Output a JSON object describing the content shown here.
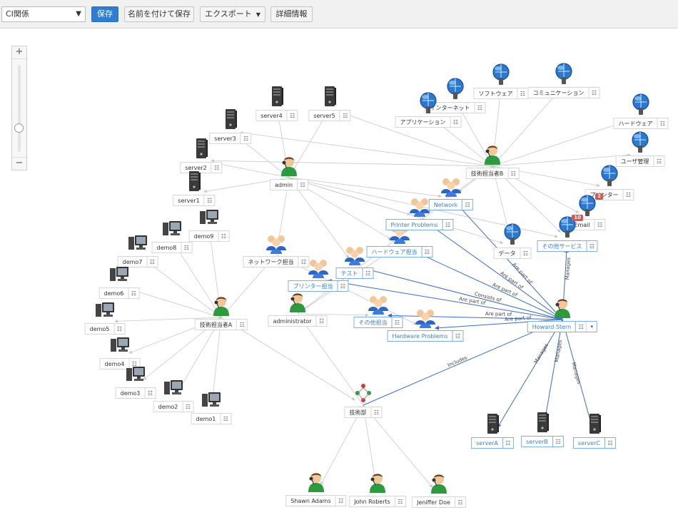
{
  "toolbar": {
    "select_value": "CI関係",
    "save": "保存",
    "save_as": "名前を付けて保存",
    "export": "エクスポート",
    "details": "詳細情報"
  },
  "zoom": {
    "in": "+",
    "out": "−",
    "level": 0.32
  },
  "colors": {
    "primary": "#2e7dd2",
    "edge": "#c8c8c8",
    "relation_edge": "#3a6cc8",
    "badge": "#d9534f"
  },
  "graph": {
    "nodes": [
      {
        "id": "ci",
        "label": "CI関係"
      },
      {
        "id": "server4",
        "label": "server4",
        "icon": "server-icon"
      },
      {
        "id": "server5",
        "label": "server5",
        "icon": "server-icon"
      },
      {
        "id": "server3",
        "label": "server3",
        "icon": "server-icon"
      },
      {
        "id": "server2",
        "label": "server2",
        "icon": "server-icon"
      },
      {
        "id": "server1",
        "label": "server1",
        "icon": "server-icon"
      },
      {
        "id": "admin",
        "label": "admin",
        "icon": "user-icon"
      },
      {
        "id": "demo9",
        "label": "demo9",
        "icon": "pc-icon"
      },
      {
        "id": "demo8",
        "label": "demo8",
        "icon": "pc-icon"
      },
      {
        "id": "demo7",
        "label": "demo7",
        "icon": "pc-icon"
      },
      {
        "id": "demo6",
        "label": "demo6",
        "icon": "pc-icon"
      },
      {
        "id": "demo5",
        "label": "demo5",
        "icon": "pc-icon"
      },
      {
        "id": "demo4",
        "label": "demo4",
        "icon": "pc-icon"
      },
      {
        "id": "demo3",
        "label": "demo3",
        "icon": "pc-icon"
      },
      {
        "id": "demo2",
        "label": "demo2",
        "icon": "pc-icon"
      },
      {
        "id": "demo1",
        "label": "demo1",
        "icon": "pc-icon"
      },
      {
        "id": "techA",
        "label": "技術担当者A",
        "icon": "user-icon"
      },
      {
        "id": "net",
        "label": "ネットワーク担当",
        "icon": "group-icon"
      },
      {
        "id": "printer_t",
        "label": "プリンター担当",
        "icon": "group-icon"
      },
      {
        "id": "test",
        "label": "テスト",
        "icon": "group-icon"
      },
      {
        "id": "administrator",
        "label": "administrator",
        "icon": "user-icon"
      },
      {
        "id": "other_t",
        "label": "その他担当",
        "icon": "group-icon"
      },
      {
        "id": "hw_t",
        "label": "ハードウェア担当",
        "icon": "group-icon"
      },
      {
        "id": "printer_p",
        "label": "Printer Problems",
        "icon": "group-icon"
      },
      {
        "id": "network",
        "label": "Network",
        "icon": "group-icon"
      },
      {
        "id": "hw_p",
        "label": "Hardware Problems",
        "icon": "group-icon"
      },
      {
        "id": "techB",
        "label": "技術担当者B",
        "icon": "user-icon"
      },
      {
        "id": "internet",
        "label": "インターネット",
        "icon": "service-icon"
      },
      {
        "id": "software",
        "label": "ソフトウェア",
        "icon": "service-icon"
      },
      {
        "id": "comm",
        "label": "コミュニケーション",
        "icon": "service-icon"
      },
      {
        "id": "app",
        "label": "アプリケーション",
        "icon": "service-icon"
      },
      {
        "id": "hardware",
        "label": "ハードウェア",
        "icon": "service-icon"
      },
      {
        "id": "usermgmt",
        "label": "ユーザ管理",
        "icon": "service-icon"
      },
      {
        "id": "printer",
        "label": "プリンター",
        "icon": "service-icon"
      },
      {
        "id": "email",
        "label": "Email",
        "icon": "service-icon",
        "badge": "2"
      },
      {
        "id": "other_s",
        "label": "その他サービス",
        "icon": "service-icon",
        "badge": "10"
      },
      {
        "id": "data",
        "label": "データ",
        "icon": "service-icon"
      },
      {
        "id": "howard",
        "label": "Howard Stern",
        "icon": "user-icon"
      },
      {
        "id": "dept",
        "label": "技術部",
        "icon": "org-icon"
      },
      {
        "id": "serverA",
        "label": "serverA",
        "icon": "server-icon"
      },
      {
        "id": "serverB",
        "label": "serverB",
        "icon": "server-icon"
      },
      {
        "id": "serverC",
        "label": "serverC",
        "icon": "server-icon"
      },
      {
        "id": "shawn",
        "label": "Shawn Adams",
        "icon": "user-icon"
      },
      {
        "id": "john",
        "label": "John Roberts",
        "icon": "user-icon"
      },
      {
        "id": "jeniffer",
        "label": "Jeniffer Doe",
        "icon": "user-icon"
      }
    ],
    "edges": [
      {
        "from": "admin",
        "to": "server4"
      },
      {
        "from": "admin",
        "to": "server5"
      },
      {
        "from": "admin",
        "to": "server3"
      },
      {
        "from": "admin",
        "to": "server2"
      },
      {
        "from": "admin",
        "to": "server1"
      },
      {
        "from": "admin",
        "to": "network"
      },
      {
        "from": "admin",
        "to": "printer_p"
      },
      {
        "from": "admin",
        "to": "hw_t"
      },
      {
        "from": "admin",
        "to": "test"
      },
      {
        "from": "admin",
        "to": "net"
      },
      {
        "from": "admin",
        "to": "other_s"
      },
      {
        "from": "admin",
        "to": "data"
      },
      {
        "from": "techB",
        "to": "internet"
      },
      {
        "from": "techB",
        "to": "software"
      },
      {
        "from": "techB",
        "to": "comm"
      },
      {
        "from": "techB",
        "to": "app"
      },
      {
        "from": "techB",
        "to": "hardware"
      },
      {
        "from": "techB",
        "to": "usermgmt"
      },
      {
        "from": "techB",
        "to": "printer"
      },
      {
        "from": "techB",
        "to": "email"
      },
      {
        "from": "techB",
        "to": "other_s"
      },
      {
        "from": "techB",
        "to": "data"
      },
      {
        "from": "techB",
        "to": "server3"
      },
      {
        "from": "techB",
        "to": "server5"
      },
      {
        "from": "techB",
        "to": "server2"
      },
      {
        "from": "techB",
        "to": "network"
      },
      {
        "from": "techB",
        "to": "printer_p"
      },
      {
        "from": "techA",
        "to": "demo9"
      },
      {
        "from": "techA",
        "to": "demo8"
      },
      {
        "from": "techA",
        "to": "demo7"
      },
      {
        "from": "techA",
        "to": "demo6"
      },
      {
        "from": "techA",
        "to": "demo5"
      },
      {
        "from": "techA",
        "to": "demo4"
      },
      {
        "from": "techA",
        "to": "demo3"
      },
      {
        "from": "techA",
        "to": "demo2"
      },
      {
        "from": "techA",
        "to": "demo1"
      },
      {
        "from": "techA",
        "to": "net"
      },
      {
        "from": "techA",
        "to": "dept"
      },
      {
        "from": "net",
        "to": "hw_p"
      },
      {
        "from": "administrator",
        "to": "other_t"
      },
      {
        "from": "administrator",
        "to": "hw_t"
      },
      {
        "from": "administrator",
        "to": "network"
      },
      {
        "from": "dept",
        "to": "administrator"
      },
      {
        "from": "dept",
        "to": "shawn"
      },
      {
        "from": "dept",
        "to": "john"
      },
      {
        "from": "dept",
        "to": "jeniffer"
      },
      {
        "from": "howard",
        "to": "network",
        "type": "relation",
        "label": "Are part of"
      },
      {
        "from": "howard",
        "to": "printer_p",
        "type": "relation",
        "label": "Are part of"
      },
      {
        "from": "howard",
        "to": "hw_t",
        "type": "relation",
        "label": "Are part of"
      },
      {
        "from": "howard",
        "to": "test",
        "type": "relation",
        "label": "Consists of"
      },
      {
        "from": "howard",
        "to": "printer_t",
        "type": "relation",
        "label": "Are part of"
      },
      {
        "from": "howard",
        "to": "other_t",
        "type": "relation",
        "label": "Are part of"
      },
      {
        "from": "howard",
        "to": "hw_p",
        "type": "relation",
        "label": "Are part of"
      },
      {
        "from": "howard",
        "to": "other_s",
        "type": "relation",
        "label": "Manages"
      },
      {
        "from": "howard",
        "to": "serverA",
        "type": "relation",
        "label": "Manages"
      },
      {
        "from": "howard",
        "to": "serverB",
        "type": "relation",
        "label": "Manages"
      },
      {
        "from": "howard",
        "to": "serverC",
        "type": "relation",
        "label": "Manages"
      },
      {
        "from": "dept",
        "to": "howard",
        "type": "relation",
        "label": "Includes"
      }
    ]
  }
}
